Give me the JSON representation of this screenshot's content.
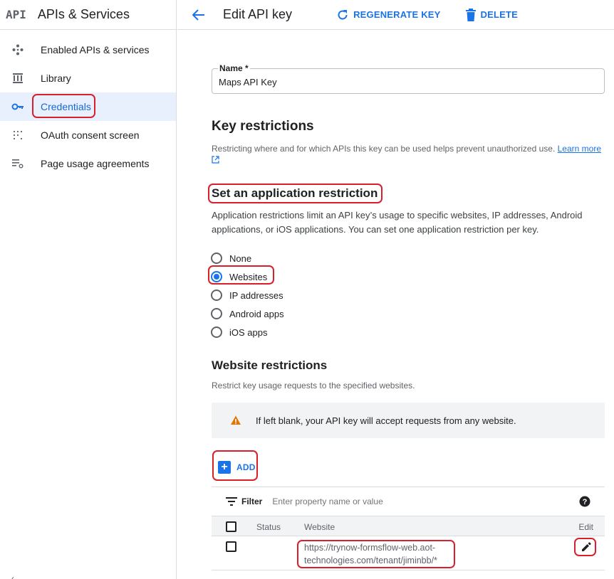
{
  "app": {
    "logo": "API",
    "title": "APIs & Services"
  },
  "sidebar": {
    "items": [
      {
        "label": "Enabled APIs & services",
        "icon": "diamond-dots-icon"
      },
      {
        "label": "Library",
        "icon": "library-icon"
      },
      {
        "label": "Credentials",
        "icon": "key-icon",
        "active": true
      },
      {
        "label": "OAuth consent screen",
        "icon": "dots-grid-icon"
      },
      {
        "label": "Page usage agreements",
        "icon": "settings-list-icon"
      }
    ]
  },
  "header": {
    "title": "Edit API key",
    "regenerate_label": "REGENERATE KEY",
    "delete_label": "DELETE"
  },
  "name_field": {
    "label": "Name *",
    "value": "Maps API Key"
  },
  "key_restrictions": {
    "heading": "Key restrictions",
    "description": "Restricting where and for which APIs this key can be used helps prevent unauthorized use.",
    "learn_more": "Learn more"
  },
  "app_restriction": {
    "heading": "Set an application restriction",
    "description": "Application restrictions limit an API key’s usage to specific websites, IP addresses, Android applications, or iOS applications. You can set one application restriction per key.",
    "options": [
      "None",
      "Websites",
      "IP addresses",
      "Android apps",
      "iOS apps"
    ],
    "selected": "Websites"
  },
  "website_restrictions": {
    "heading": "Website restrictions",
    "description": "Restrict key usage requests to the specified websites.",
    "warning": "If left blank, your API key will accept requests from any website.",
    "add_label": "ADD",
    "filter_label": "Filter",
    "filter_placeholder": "Enter property name or value",
    "columns": {
      "status": "Status",
      "website": "Website",
      "edit": "Edit"
    },
    "rows": [
      {
        "status": "",
        "website": "https://trynow-formsflow-web.aot-technologies.com/tenant/jiminbb/*"
      }
    ]
  },
  "colors": {
    "accent": "#1a73e8",
    "active_bg": "#e8f0fe",
    "warning": "#e37400",
    "annotation": "#d9202a"
  }
}
